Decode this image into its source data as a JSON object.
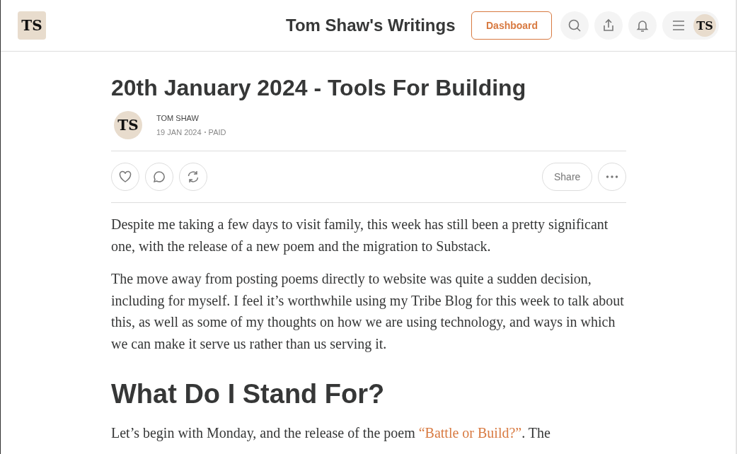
{
  "header": {
    "logo": "TS",
    "title": "Tom Shaw's Writings",
    "dashboard_button": "Dashboard",
    "avatar": "TS"
  },
  "post": {
    "title": "20th January 2024 - Tools For Building",
    "author_avatar": "TS",
    "author": "TOM SHAW",
    "date": "19 JAN 2024",
    "access": "PAID",
    "share_button": "Share",
    "paragraphs": [
      "Despite me taking a few days to visit family, this week has still been a pretty significant one, with the release of a new poem and the migration to Substack.",
      "The move away from posting poems directly to website was quite a sudden decision, including for myself. I feel it’s worthwhile using my Tribe Blog for this week to talk about this, as well as some of my thoughts on how we are using technology, and ways in which we can make it serve us rather than us serving it."
    ],
    "heading": "What Do I Stand For?",
    "last_paragraph": {
      "before": "Let’s begin with Monday, and the release of the poem ",
      "link": "“Battle or Build?”",
      "after": ". The"
    }
  }
}
